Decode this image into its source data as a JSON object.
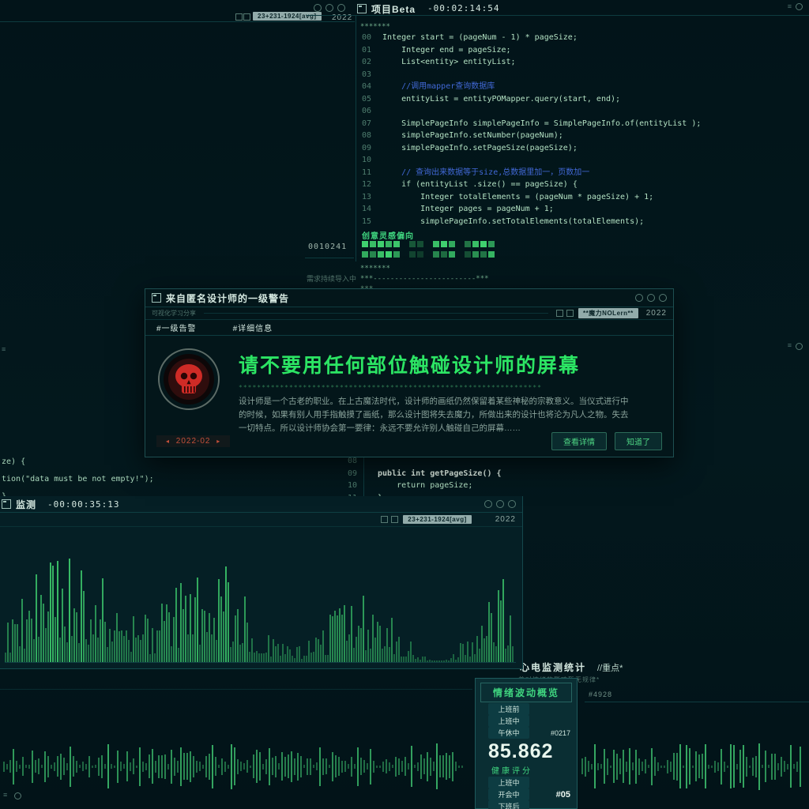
{
  "top_window": {
    "title": "项目Beta",
    "timer": "-00:02:14:54",
    "tag": "23+231-1924[avg]",
    "year": "2022",
    "top_stars": "*******",
    "code": [
      {
        "ln": "00",
        "text": "Integer start = (pageNum - 1) * pageSize;"
      },
      {
        "ln": "01",
        "text": "    Integer end = pageSize;"
      },
      {
        "ln": "02",
        "text": "    List<entity> entityList;"
      },
      {
        "ln": "03",
        "text": ""
      },
      {
        "ln": "04",
        "text": "    //调用mapper查询数据库",
        "cls": "comment"
      },
      {
        "ln": "05",
        "text": "    entityList = entityPOMapper.query(start, end);"
      },
      {
        "ln": "06",
        "text": ""
      },
      {
        "ln": "07",
        "text": "    SimplePageInfo simplePageInfo = SimplePageInfo.of(entityList );"
      },
      {
        "ln": "08",
        "text": "    simplePageInfo.setNumber(pageNum);"
      },
      {
        "ln": "09",
        "text": "    simplePageInfo.setPageSize(pageSize);"
      },
      {
        "ln": "10",
        "text": ""
      },
      {
        "ln": "11",
        "text": "    // 查询出来数据等于size,总数据里加一，页数加一",
        "cls": "comment"
      },
      {
        "ln": "12",
        "text": "    if (entityList .size() == pageSize) {"
      },
      {
        "ln": "13",
        "text": "        Integer totalElements = (pageNum * pageSize) + 1;"
      },
      {
        "ln": "14",
        "text": "        Integer pages = pageNum + 1;"
      },
      {
        "ln": "15",
        "text": "        simplePageInfo.setTotalElements(totalElements);"
      }
    ],
    "inspiration_label": "创意灵感偏向",
    "inspiration_rows": [
      [
        1,
        0.9,
        1,
        0.85,
        0.95,
        0,
        0.35,
        0.3,
        0,
        0.9,
        1,
        0.8,
        0,
        0.5,
        0.9,
        1,
        0.7
      ],
      [
        0.8,
        0.6,
        0.9,
        1,
        0.7,
        0,
        0.25,
        0.2,
        0,
        0.6,
        0.45,
        0.8,
        0,
        0.3,
        0.65,
        0.5,
        0.85
      ]
    ],
    "trailing_marks": [
      "*******",
      "***------------------------***",
      "***"
    ],
    "counter": "0010241",
    "status_note": "需求持续导入中"
  },
  "warning_modal": {
    "title": "来自匿名设计师的一级警告",
    "subbar_left": "可视化学习分享",
    "subbar_tag": "**魔力NOLern**",
    "year": "2022",
    "tabs": [
      "#一级告警",
      "#详细信息"
    ],
    "heading": "请不要用任何部位触碰设计师的屏幕",
    "stars": "******************************************************************",
    "paragraph": [
      "设计师是一个古老的职业。在上古魔法时代，设计师的画纸仍然保留着某些神秘的宗教意义。当仪式进行中",
      "的时候，如果有别人用手指触摸了画纸，那么设计图将失去魔力，所做出来的设计也将沦为凡人之物。失去",
      "一切特点。所以设计师协会第一要律：永远不要允许别人触碰自己的屏幕……"
    ],
    "date": "2022-02",
    "buttons": [
      "查看详情",
      "知道了"
    ]
  },
  "background": {
    "left_code": [
      "ze) {",
      "tion(\"data must be not empty!\");",
      "}"
    ],
    "right_code": [
      {
        "ln": "08",
        "text": ""
      },
      {
        "ln": "09",
        "text": "public int getPageSize() {",
        "cls": "kw"
      },
      {
        "ln": "10",
        "text": "    return pageSize;"
      },
      {
        "ln": "11",
        "text": "}"
      }
    ]
  },
  "monitor_window": {
    "title": "监测",
    "timer": "-00:00:35:13",
    "tag": "23+231-1924[avg]",
    "year": "2022"
  },
  "ecg": {
    "title": "心电监测统计",
    "note": "//重点*",
    "subtitle": "养对情绪的影响暂无规律*",
    "side_tag": "#4928",
    "panel": {
      "header": "情绪波动概览",
      "rows_top": [
        {
          "label": "上班前"
        },
        {
          "label": "上班中"
        },
        {
          "label": "午休中",
          "tag": "#0217"
        }
      ],
      "score": "85.862",
      "score_label": "健康评分",
      "rows_bottom": [
        {
          "label": "上班中"
        },
        {
          "label": "开会中",
          "tag": "#05",
          "bold": true
        },
        {
          "label": "下班后"
        }
      ]
    }
  },
  "visuals": {
    "spectrum": {
      "count": 215,
      "max": 160,
      "seed": 9
    },
    "wave_left": {
      "count": 146,
      "max": 56,
      "seed": 21
    },
    "wave_right": {
      "count": 70,
      "max": 56,
      "seed": 33
    }
  },
  "colors": {
    "accent_green": "#2ce564",
    "alert_red": "#cf2b26",
    "comment_blue": "#4169d6"
  }
}
